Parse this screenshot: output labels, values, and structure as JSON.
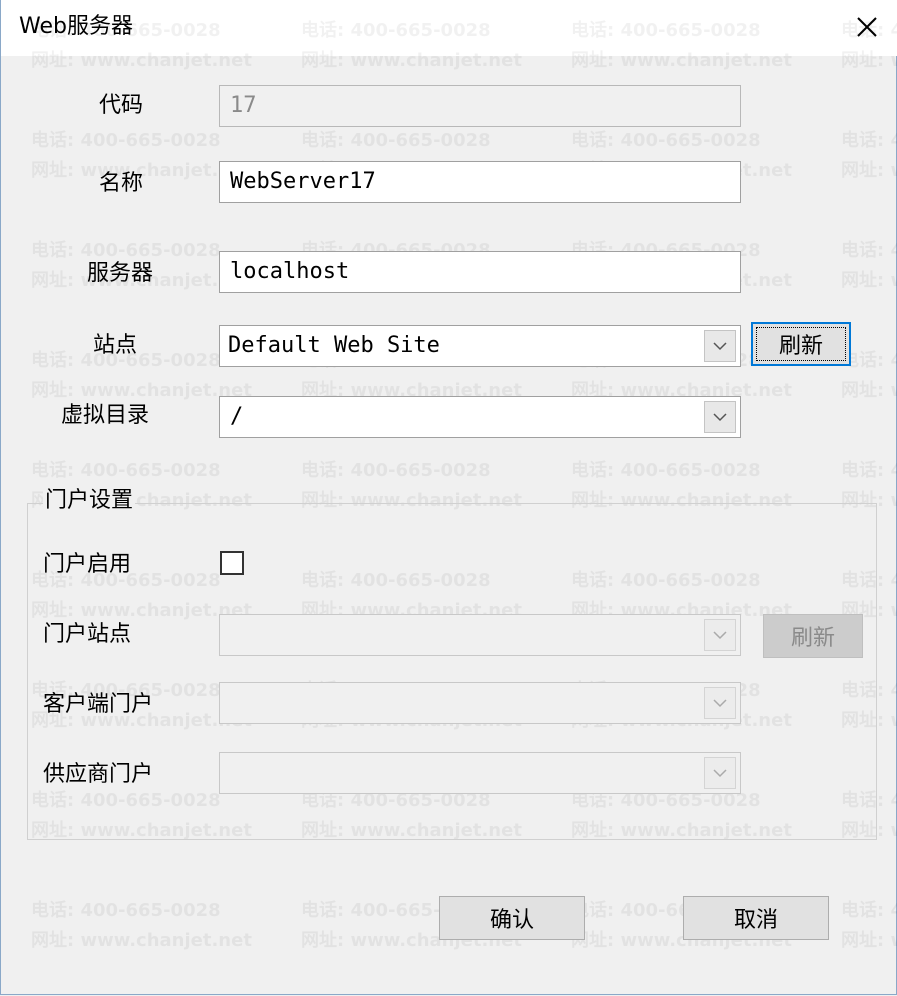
{
  "window": {
    "title": "Web服务器"
  },
  "watermark": {
    "phone": "电话: 400-665-0028",
    "site": "网址: www.chanjet.net"
  },
  "form": {
    "code_label": "代码",
    "code_value": "17",
    "name_label": "名称",
    "name_value": "WebServer17",
    "server_label": "服务器",
    "server_value": "localhost",
    "site_label": "站点",
    "site_value": "Default Web Site",
    "site_refresh_label": "刷新",
    "vdir_label": "虚拟目录",
    "vdir_value": "/"
  },
  "portal": {
    "group_title": "门户设置",
    "enable_label": "门户启用",
    "enable_checked": false,
    "site_label": "门户站点",
    "site_value": "",
    "site_refresh_label": "刷新",
    "customer_label": "客户端门户",
    "customer_value": "",
    "supplier_label": "供应商门户",
    "supplier_value": ""
  },
  "footer": {
    "confirm_label": "确认",
    "cancel_label": "取消"
  }
}
